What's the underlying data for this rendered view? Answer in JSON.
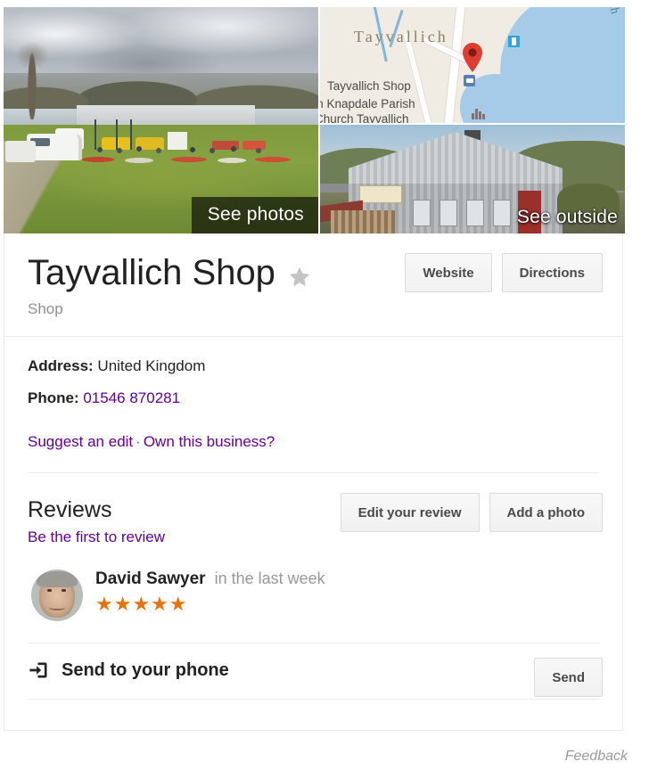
{
  "media": {
    "photos_badge": "See photos",
    "outside_badge": "See outside",
    "map": {
      "town_label": "Tayvallich",
      "poi_shop": "Tayvallich Shop",
      "poi_church_line1": "rth Knapdale Parish",
      "poi_church_line2": "Church Tayvallich",
      "loch_label": "ch a' Bhealaich"
    }
  },
  "header": {
    "title": "Tayvallich Shop",
    "subtitle": "Shop",
    "save_star": "save-star",
    "buttons": [
      {
        "label": "Website"
      },
      {
        "label": "Directions"
      }
    ]
  },
  "info": {
    "address_label": "Address:",
    "address_value": "United Kingdom",
    "phone_label": "Phone:",
    "phone_value": "01546 870281",
    "suggest_edit": "Suggest an edit",
    "separator": "·",
    "own_business": "Own this business?"
  },
  "reviews": {
    "heading": "Reviews",
    "be_first_link": "Be the first to review",
    "buttons": [
      {
        "label": "Edit your review"
      },
      {
        "label": "Add a photo"
      }
    ],
    "items": [
      {
        "name": "David Sawyer",
        "time": "in the last week",
        "stars": "★★★★★",
        "rating": 5
      }
    ]
  },
  "send_to_phone": {
    "label": "Send to your phone",
    "button_label": "Send",
    "icon": "send-to-device-icon"
  },
  "footer": {
    "feedback": "Feedback"
  },
  "colors": {
    "link": "#660099",
    "star_rating": "#e8730a",
    "save_star": "#c0c0c0",
    "border": "#ebebeb",
    "map_pin": "#e03c31"
  }
}
